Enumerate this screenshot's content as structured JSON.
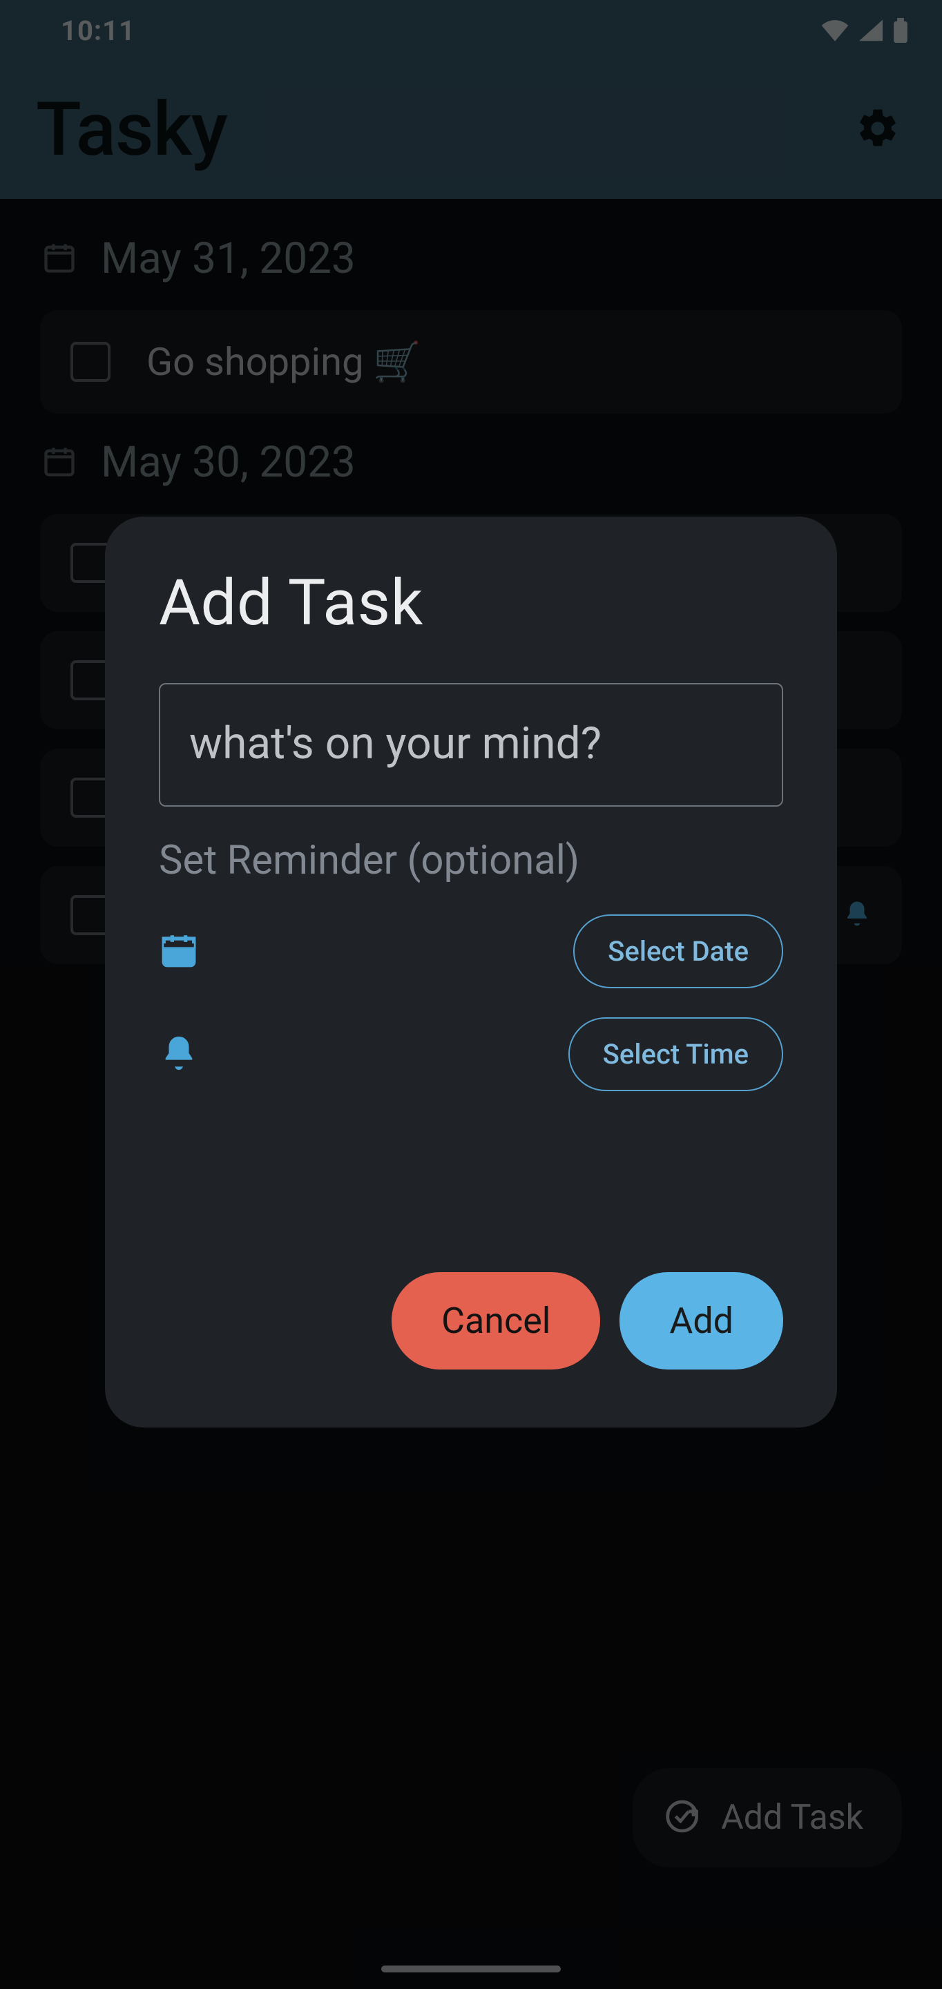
{
  "statusbar": {
    "time": "10:11"
  },
  "app": {
    "title": "Tasky"
  },
  "fab": {
    "label": "Add Task"
  },
  "groups": [
    {
      "date": "May 31, 2023",
      "tasks": [
        {
          "text": "Go shopping 🛒",
          "has_reminder": false
        }
      ]
    },
    {
      "date": "May 30, 2023",
      "tasks": [
        {
          "text": "",
          "has_reminder": false
        },
        {
          "text": "",
          "has_reminder": false
        },
        {
          "text": "",
          "has_reminder": false
        },
        {
          "text": "",
          "has_reminder": true
        }
      ]
    }
  ],
  "dialog": {
    "title": "Add Task",
    "input_placeholder": "what's on your mind?",
    "input_value": "",
    "section_label": "Set Reminder (optional)",
    "select_date": "Select Date",
    "select_time": "Select Time",
    "cancel": "Cancel",
    "add": "Add"
  },
  "chart_data": null
}
